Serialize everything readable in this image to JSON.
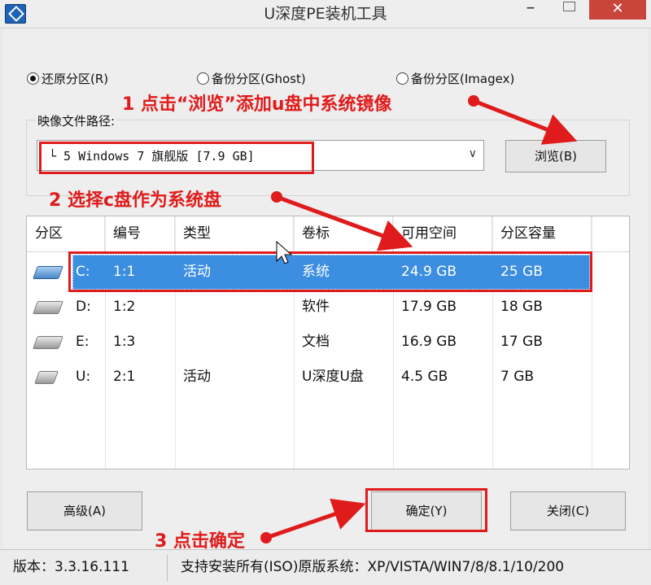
{
  "window": {
    "title": "U深度PE装机工具",
    "min": "–",
    "close": "✕"
  },
  "mode": {
    "options": [
      {
        "label": "还原分区(R)",
        "checked": true
      },
      {
        "label": "备份分区(Ghost)",
        "checked": false
      },
      {
        "label": "备份分区(Imagex)",
        "checked": false
      }
    ]
  },
  "image_path": {
    "label": "映像文件路径:",
    "value": "└ 5 Windows 7 旗舰版 [7.9 GB]",
    "browse_label": "浏览(B)"
  },
  "partitions": {
    "columns": [
      "分区",
      "编号",
      "类型",
      "卷标",
      "可用空间",
      "分区容量"
    ],
    "rows": [
      {
        "drive": "C:",
        "num": "1:1",
        "type": "活动",
        "label": "系统",
        "free": "24.9 GB",
        "size": "25 GB",
        "selected": true,
        "icon": "system-drive-icon"
      },
      {
        "drive": "D:",
        "num": "1:2",
        "type": "",
        "label": "软件",
        "free": "17.9 GB",
        "size": "18 GB",
        "selected": false,
        "icon": "hard-drive-icon"
      },
      {
        "drive": "E:",
        "num": "1:3",
        "type": "",
        "label": "文档",
        "free": "16.9 GB",
        "size": "17 GB",
        "selected": false,
        "icon": "hard-drive-icon"
      },
      {
        "drive": "U:",
        "num": "2:1",
        "type": "活动",
        "label": "U深度U盘",
        "free": "4.5 GB",
        "size": "7 GB",
        "selected": false,
        "icon": "usb-drive-icon"
      }
    ]
  },
  "buttons": {
    "advanced": "高级(A)",
    "ok": "确定(Y)",
    "close": "关闭(C)"
  },
  "annotations": {
    "step1": "1 点击“浏览”添加u盘中系统镜像",
    "step2": "2 选择c盘作为系统盘",
    "step3": "3 点击确定"
  },
  "status": {
    "version": "版本：3.3.16.111",
    "support": "支持安装所有(ISO)原版系统：XP/VISTA/WIN7/8/8.1/10/200"
  },
  "colors": {
    "annotation": "#e01b1b",
    "selection": "#3c8ee0",
    "close_button": "#c9453b"
  }
}
